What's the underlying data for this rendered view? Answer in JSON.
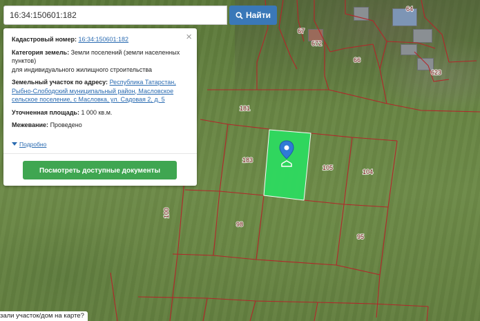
{
  "search": {
    "value": "16:34:150601:182",
    "button_label": "Найти"
  },
  "card": {
    "cadastral_label": "Кадастровый номер:",
    "cadastral_value": "16:34:150601:182",
    "category_label": "Категория земель:",
    "category_value": "Земли поселений (земли населенных пунктов)",
    "category_value_2": "для индивидуального жилищного строительства",
    "address_label": "Земельный участок по адресу:",
    "address_line_1": "Республика Татарстан,",
    "address_line_2": "Рыбно-Слободский муниципальный район, Масловское",
    "address_line_3": "сельское поселение, с Масловка, ул. Садовая 2, д. 5",
    "area_label": "Уточненная площадь:",
    "area_value": "1 000 кв.м.",
    "survey_label": "Межевание:",
    "survey_value": "Проведено",
    "more_label": "Подробно",
    "docs_button": "Посмотреть доступные документы",
    "close_symbol": "×"
  },
  "hint": "зали участок/дом на карте?",
  "parcels": {
    "labels": [
      "64",
      "67",
      "672",
      "66",
      "623",
      "181",
      "183",
      "105",
      "104",
      "100",
      "98",
      "95"
    ]
  },
  "colors": {
    "search_button": "#3a78b8",
    "docs_button": "#3fa651",
    "selected_parcel": "#2fd95f",
    "boundary": "#b3262a",
    "link": "#2a6bb1"
  }
}
